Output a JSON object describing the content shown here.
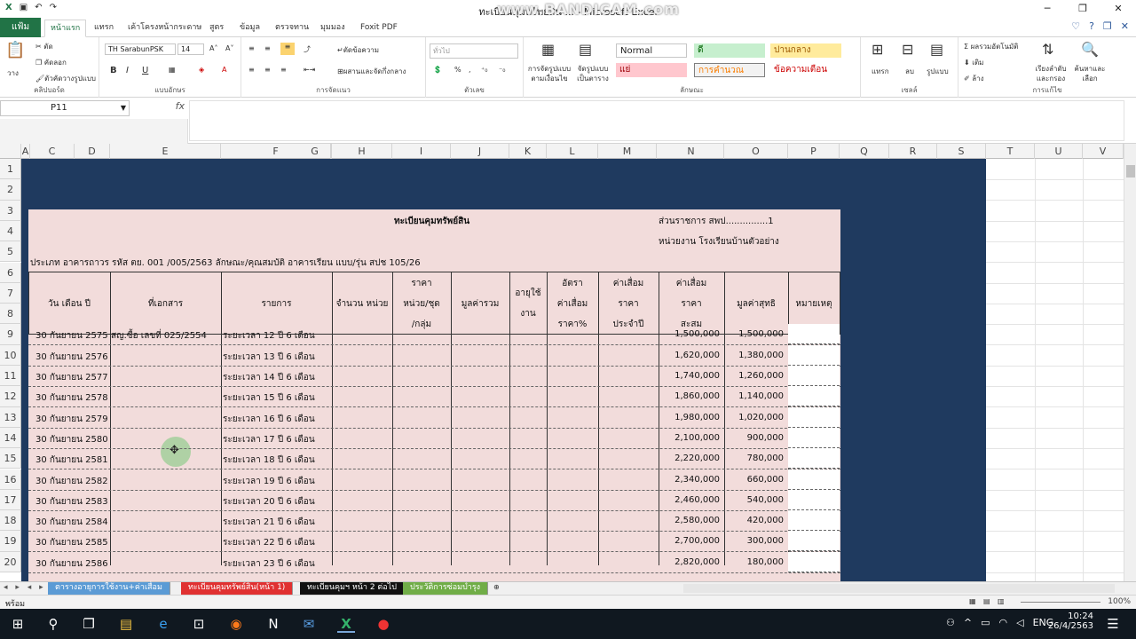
{
  "window": {
    "title": "ทะเบียนคุมทรัพย์สิน ... - Microsoft Excel",
    "watermark": "www.BANDICAM.com",
    "controls": [
      "─",
      "❐",
      "✕"
    ]
  },
  "ribbon_tabs": {
    "file": "แฟ้ม",
    "tabs": [
      "หน้าแรก",
      "แทรก",
      "เค้าโครงหน้ากระดาษ",
      "สูตร",
      "ข้อมูล",
      "ตรวจทาน",
      "มุมมอง",
      "Foxit PDF"
    ],
    "help_icons": [
      "♡",
      "?",
      "❐",
      "✕"
    ]
  },
  "ribbon": {
    "clipboard": {
      "paste": "วาง",
      "cut": "ตัด",
      "copy": "คัดลอก",
      "format_painter": "ตัวคัดวางรูปแบบ",
      "label": "คลิปบอร์ด"
    },
    "font": {
      "name": "TH SarabunPSK",
      "size": "14",
      "label": "แบบอักษร",
      "grow": "A˄",
      "shrink": "A˅",
      "bold": "B",
      "italic": "I",
      "underline": "U"
    },
    "alignment": {
      "wrap": "ตัดข้อความ",
      "merge": "ผสานและจัดกึ่งกลาง",
      "label": "การจัดแนว"
    },
    "number": {
      "format": "ทั่วไป",
      "label": "ตัวเลข",
      "percent": "%",
      "comma": ","
    },
    "styles": {
      "cond_format": "การจัดรูปแบบ ตามเงื่อนไข",
      "as_table": "จัดรูปแบบ เป็นตาราง",
      "label": "ลักษณะ",
      "cells": [
        "Normal",
        "ดี",
        "ปานกลาง",
        "แย่",
        "การคำนวณ",
        "ข้อความเตือน"
      ]
    },
    "cells": {
      "insert": "แทรก",
      "delete": "ลบ",
      "format": "รูปแบบ",
      "label": "เซลล์"
    },
    "editing": {
      "autosum": "ผลรวมอัตโนมัติ",
      "fill": "เติม",
      "clear": "ล้าง",
      "sort": "เรียงลำดับ และกรอง",
      "find": "ค้นหาและ เลือก",
      "label": "การแก้ไข"
    }
  },
  "formula_bar": {
    "name_box": "P11",
    "fx": "fx",
    "value": ""
  },
  "columns": [
    "A",
    "C",
    "D",
    "E",
    "F",
    "G",
    "H",
    "I",
    "J",
    "K",
    "L",
    "M",
    "N",
    "O",
    "P",
    "Q",
    "R",
    "S",
    "T",
    "U",
    "V"
  ],
  "row_numbers": [
    "1",
    "2",
    "3",
    "4",
    "5",
    "6",
    "7",
    "8",
    "9",
    "10",
    "11",
    "12",
    "13",
    "14",
    "15",
    "16",
    "17",
    "18",
    "19",
    "20"
  ],
  "sheet": {
    "title": "ทะเบียนคุมทรัพย์สิน",
    "dept_line": "ส่วนราชการ  สพป...............1",
    "unit_line": "หน่วยงาน  โรงเรียนบ้านตัวอย่าง",
    "info_line": "ประเภท อาคารถาวร    รหัส ตย. 001 /005/2563   ลักษณะ/คุณสมบัติ อาคารเรียน     แบบ/รุ่น สปช 105/26",
    "headers": {
      "date": "วัน เดือน ปี",
      "doc": "ที่เอกสาร",
      "item": "รายการ",
      "qty": "จำนวน หน่วย",
      "price": [
        "ราคา",
        "หน่วย/ชุด",
        "/กลุ่ม"
      ],
      "total": "มูลค่ารวม",
      "life": [
        "อายุใช้",
        "งาน"
      ],
      "rate": [
        "อัตรา",
        "ค่าเสื่อม",
        "ราคา%"
      ],
      "annual": [
        "ค่าเสื่อม",
        "ราคา",
        "ประจำปี"
      ],
      "accum": [
        "ค่าเสื่อม",
        "ราคา",
        "สะสม"
      ],
      "net": "มูลค่าสุทธิ",
      "note": "หมายเหตุ"
    },
    "rows": [
      {
        "date": "30 กันยายน 2575",
        "doc": "สญ.ซื้อ เลขที่ 025/2554",
        "item": "ระยะเวลา 12 ปี 6 เดือน",
        "accum": "1,500,000",
        "net": "1,500,000"
      },
      {
        "date": "30 กันยายน 2576",
        "doc": "",
        "item": "ระยะเวลา 13 ปี 6 เดือน",
        "accum": "1,620,000",
        "net": "1,380,000"
      },
      {
        "date": "30 กันยายน 2577",
        "doc": "",
        "item": "ระยะเวลา 14 ปี 6 เดือน",
        "accum": "1,740,000",
        "net": "1,260,000"
      },
      {
        "date": "30 กันยายน 2578",
        "doc": "",
        "item": "ระยะเวลา 15 ปี 6 เดือน",
        "accum": "1,860,000",
        "net": "1,140,000"
      },
      {
        "date": "30 กันยายน 2579",
        "doc": "",
        "item": "ระยะเวลา 16 ปี 6 เดือน",
        "accum": "1,980,000",
        "net": "1,020,000"
      },
      {
        "date": "30 กันยายน 2580",
        "doc": "",
        "item": "ระยะเวลา 17 ปี 6 เดือน",
        "accum": "2,100,000",
        "net": "900,000"
      },
      {
        "date": "30 กันยายน 2581",
        "doc": "",
        "item": "ระยะเวลา 18 ปี 6 เดือน",
        "accum": "2,220,000",
        "net": "780,000"
      },
      {
        "date": "30 กันยายน 2582",
        "doc": "",
        "item": "ระยะเวลา 19 ปี 6 เดือน",
        "accum": "2,340,000",
        "net": "660,000"
      },
      {
        "date": "30 กันยายน 2583",
        "doc": "",
        "item": "ระยะเวลา 20 ปี 6 เดือน",
        "accum": "2,460,000",
        "net": "540,000"
      },
      {
        "date": "30 กันยายน 2584",
        "doc": "",
        "item": "ระยะเวลา 21 ปี 6 เดือน",
        "accum": "2,580,000",
        "net": "420,000"
      },
      {
        "date": "30 กันยายน 2585",
        "doc": "",
        "item": "ระยะเวลา 22 ปี 6 เดือน",
        "accum": "2,700,000",
        "net": "300,000"
      },
      {
        "date": "30 กันยายน 2586",
        "doc": "",
        "item": "ระยะเวลา 23 ปี 6 เดือน",
        "accum": "2,820,000",
        "net": "180,000"
      }
    ]
  },
  "sheet_tabs": [
    {
      "label": "ตารางอายุการใช้งาน+ค่าเสื่อม",
      "color": "#5b9bd5"
    },
    {
      "label": "ทะเบียนคุมทรัพย์สิน(หน้า 1)",
      "color": "#e03131"
    },
    {
      "label": "ทะเบียนคุมฯ หน้า 2 ต่อไป",
      "color": "#111111"
    },
    {
      "label": "ประวัติการซ่อมบำรุง",
      "color": "#70ad47"
    }
  ],
  "sheet_nav": "◂ ▸ ◂ ▸",
  "status": {
    "ready": "พร้อม",
    "zoom": "100%"
  },
  "taskbar": {
    "time": "10:24",
    "date": "26/4/2563",
    "lang": "ENG",
    "icons": [
      "⊞",
      "⚲",
      "❐",
      "▤",
      "⊡",
      "e",
      "◉",
      "N",
      "✉",
      "X",
      "●"
    ]
  }
}
